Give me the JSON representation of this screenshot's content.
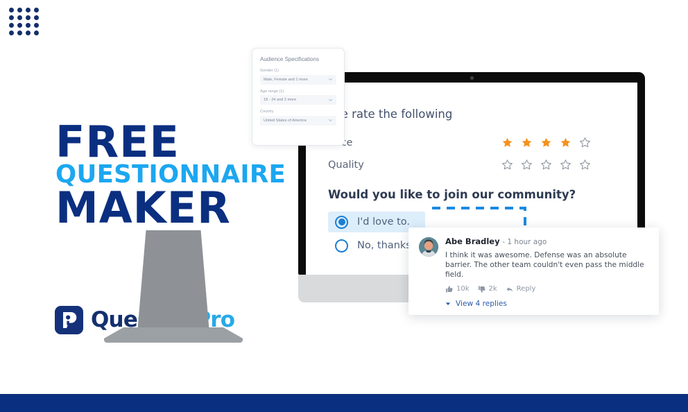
{
  "headline": {
    "line1": "FREE",
    "line2": "QUESTIONNAIRE",
    "line3": "MAKER"
  },
  "logo": {
    "mark_letter": "P",
    "word_primary": "Question",
    "word_accent": "Pro"
  },
  "audience_panel": {
    "title": "Audience Specifications",
    "fields": [
      {
        "label": "Gender (1)",
        "value": "Male, Female and 1 more"
      },
      {
        "label": "Age range (1)",
        "value": "18 - 24 and 2 more"
      },
      {
        "label": "Country",
        "value": "United States of America"
      }
    ]
  },
  "survey": {
    "title": "ase rate the following",
    "ratings": [
      {
        "label": "rvice",
        "filled": 4,
        "total": 5
      },
      {
        "label": "Quality",
        "filled": 0,
        "total": 5
      }
    ],
    "community_question": "Would you like to join our community?",
    "options": [
      {
        "label": "I'd love to.",
        "selected": true
      },
      {
        "label": "No, thanks.",
        "selected": false
      }
    ]
  },
  "comment": {
    "author": "Abe Bradley",
    "time": "- 1 hour ago",
    "text": "I think it was awesome. Defense was an absolute barrier. The other team couldn't even pass the middle field.",
    "likes": "10k",
    "dislikes": "2k",
    "reply_label": "Reply",
    "view_replies_label": "View 4 replies"
  },
  "colors": {
    "navy": "#0b2f80",
    "cyan": "#1ca7f0",
    "star_filled": "#f5921e",
    "radio_blue": "#1b7fd4",
    "bottom_bar": "#0b2f80"
  }
}
